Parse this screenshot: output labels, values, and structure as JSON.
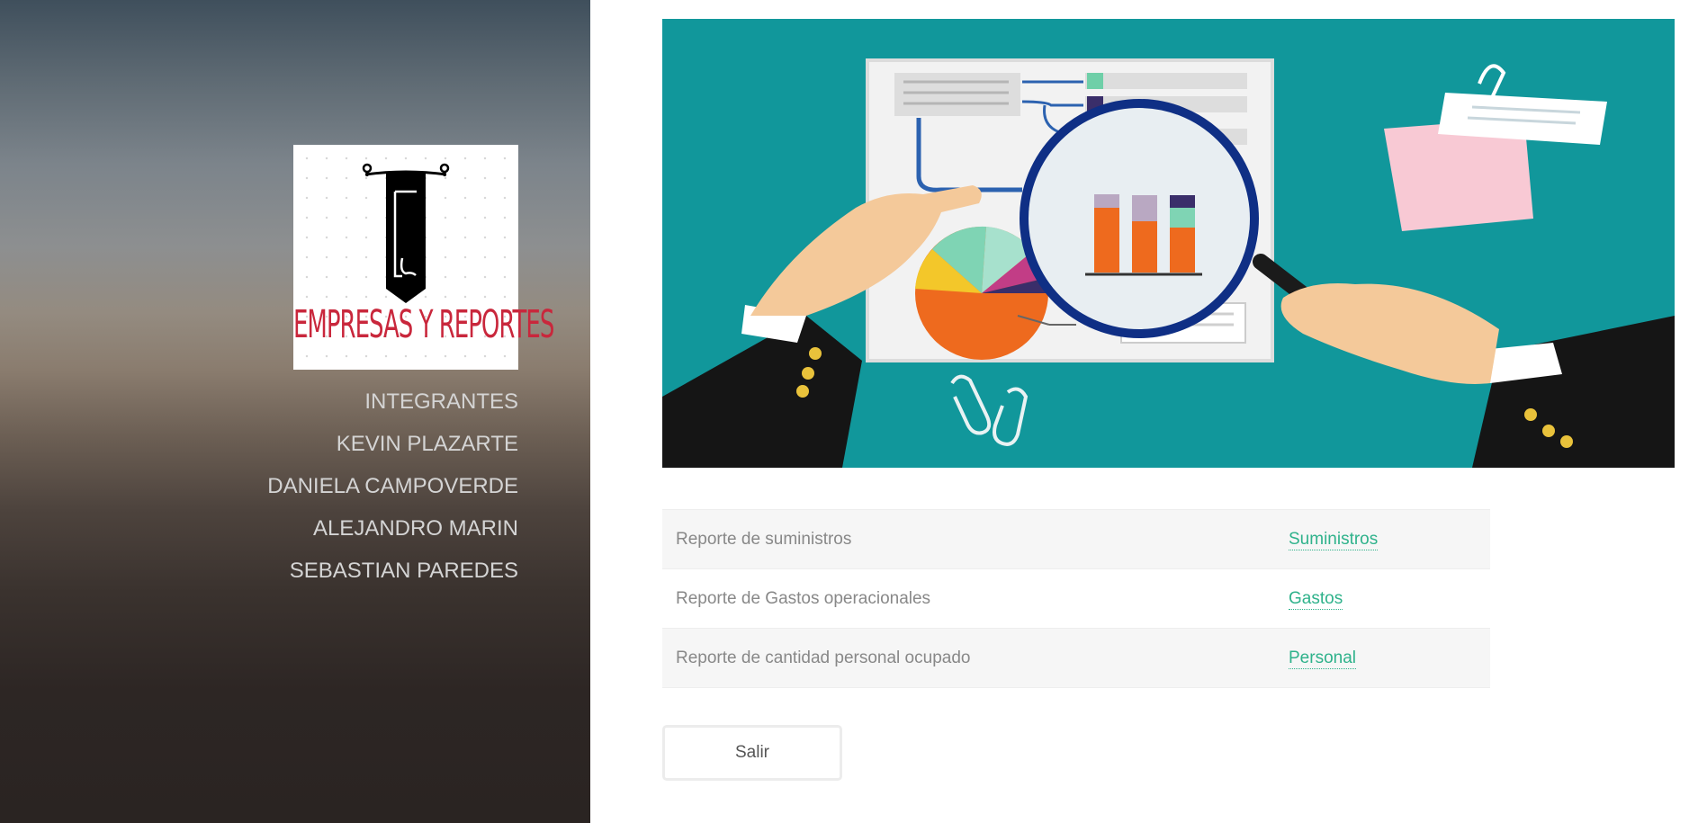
{
  "sidebar": {
    "logo_text": "EMPRESAS Y REPORTES",
    "nav": [
      {
        "label": "INTEGRANTES"
      },
      {
        "label": "KEVIN PLAZARTE"
      },
      {
        "label": "DANIELA CAMPOVERDE"
      },
      {
        "label": "ALEJANDRO MARIN"
      },
      {
        "label": "SEBASTIAN PAREDES"
      }
    ]
  },
  "hero": {
    "icon": "report-analysis-illustration"
  },
  "reports": {
    "rows": [
      {
        "description": "Reporte de suministros",
        "link": "Suministros"
      },
      {
        "description": "Reporte de Gastos operacionales",
        "link": "Gastos"
      },
      {
        "description": "Reporte de cantidad personal ocupado",
        "link": "Personal"
      }
    ]
  },
  "actions": {
    "exit_label": "Salir"
  },
  "colors": {
    "link": "#2fb28b",
    "hero_background": "#11979b",
    "logo_text": "#c9273c"
  }
}
